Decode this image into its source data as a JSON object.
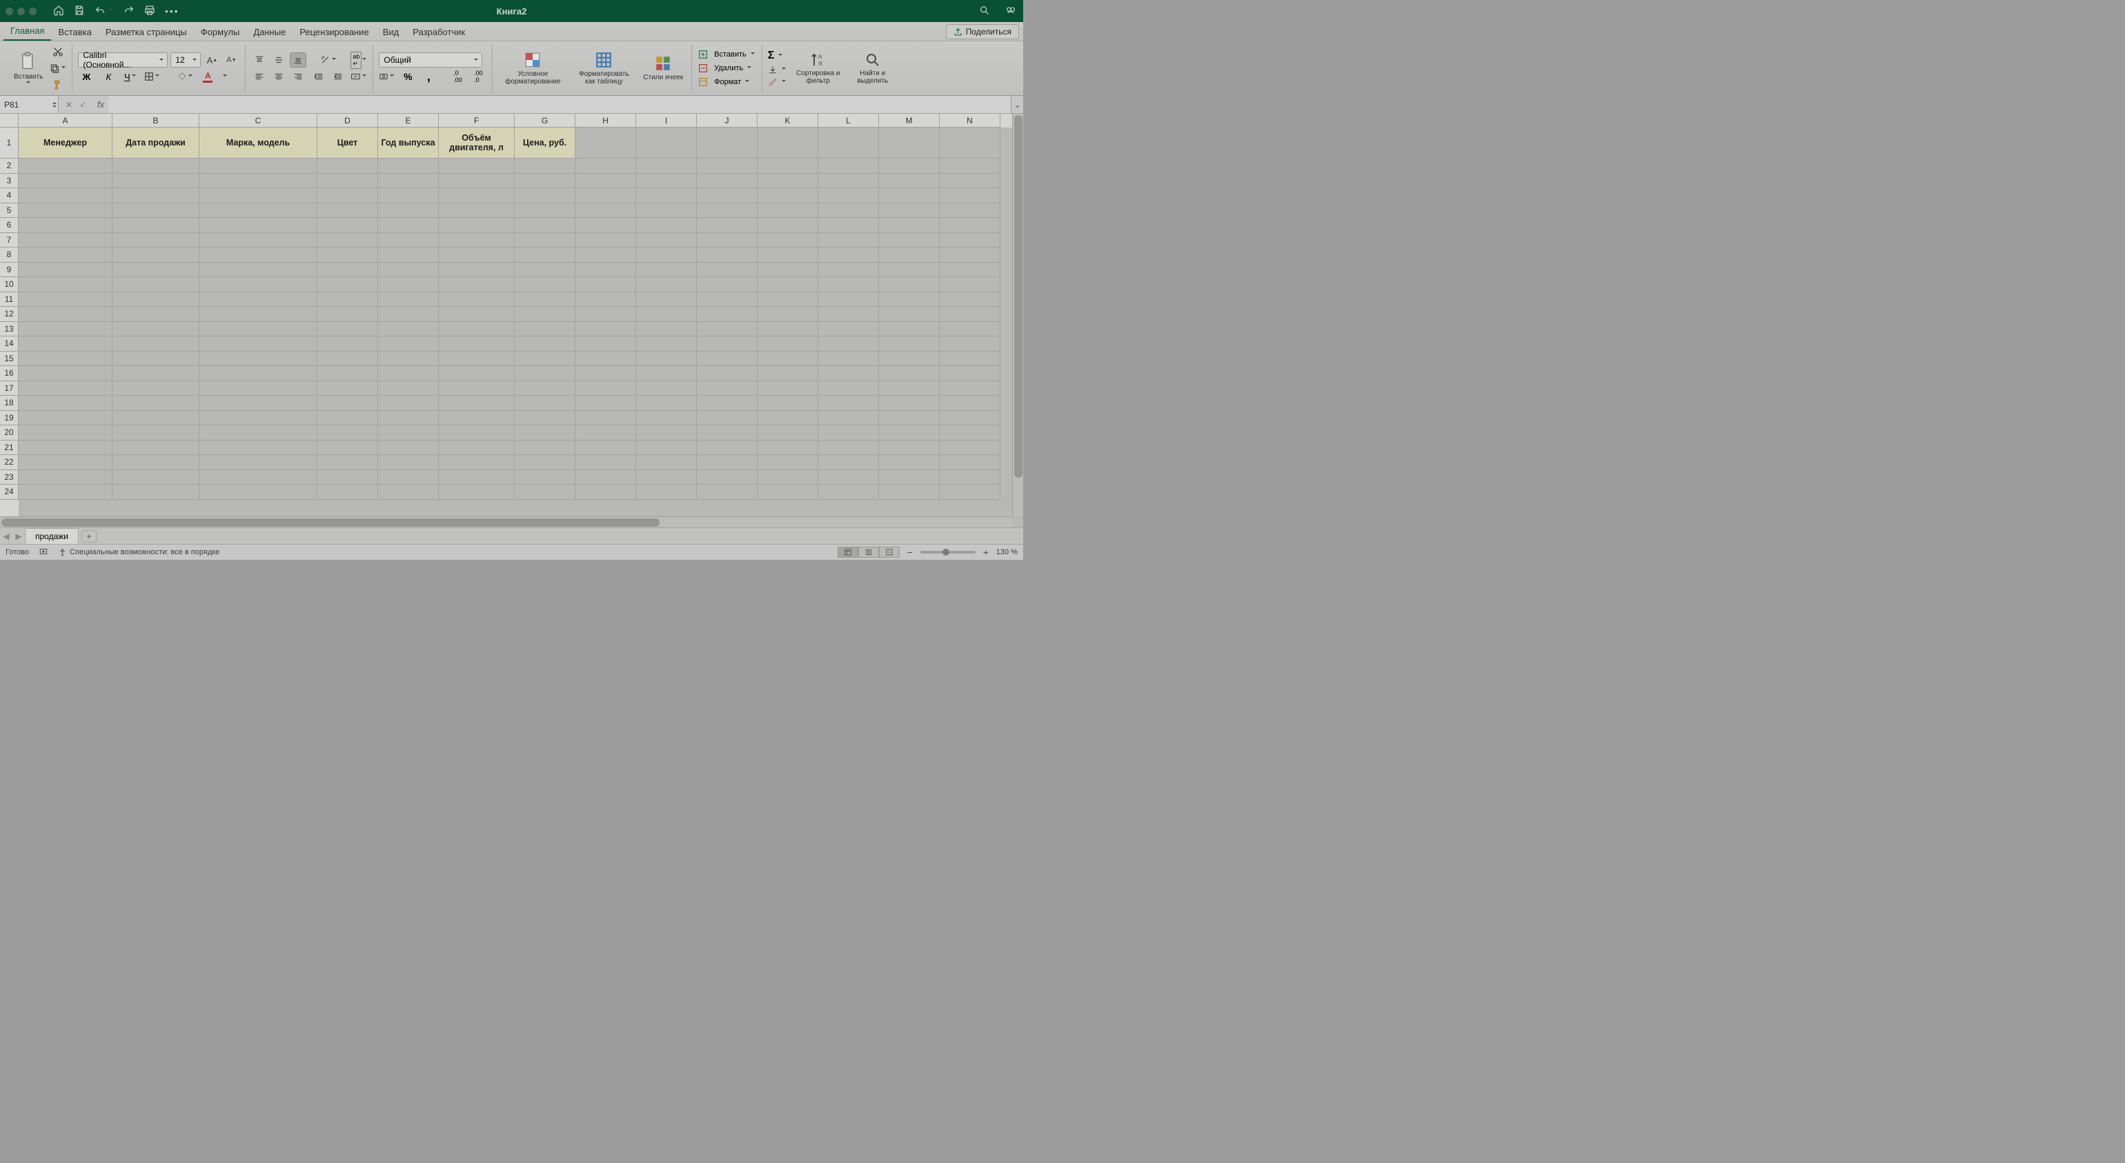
{
  "title": "Книга2",
  "tabs": [
    "Главная",
    "Вставка",
    "Разметка страницы",
    "Формулы",
    "Данные",
    "Рецензирование",
    "Вид",
    "Разработчик"
  ],
  "activeTab": 0,
  "share": "Поделиться",
  "clipboard": {
    "paste": "Вставить"
  },
  "font": {
    "name": "Calibri (Основной...",
    "size": "12"
  },
  "numberFormat": "Общий",
  "ribbonBtns": {
    "condFmt": "Условное форматирование",
    "fmtTable": "Форматировать как таблицу",
    "cellStyles": "Стили ячеек",
    "insert": "Вставить",
    "delete": "Удалить",
    "format": "Формат",
    "sort": "Сортировка и фильтр",
    "find": "Найти и выделить"
  },
  "nameBox": "P81",
  "columns": [
    {
      "l": "A",
      "w": 136
    },
    {
      "l": "B",
      "w": 126
    },
    {
      "l": "C",
      "w": 171
    },
    {
      "l": "D",
      "w": 88
    },
    {
      "l": "E",
      "w": 88
    },
    {
      "l": "F",
      "w": 110
    },
    {
      "l": "G",
      "w": 88
    },
    {
      "l": "H",
      "w": 88
    },
    {
      "l": "I",
      "w": 88
    },
    {
      "l": "J",
      "w": 88
    },
    {
      "l": "K",
      "w": 88
    },
    {
      "l": "L",
      "w": 88
    },
    {
      "l": "M",
      "w": 88
    },
    {
      "l": "N",
      "w": 88
    }
  ],
  "headerRow": [
    "Менеджер",
    "Дата продажи",
    "Марка, модель",
    "Цвет",
    "Год выпуска",
    "Объём двигателя, л",
    "Цена, руб."
  ],
  "rowCount": 24,
  "sheetName": "продажи",
  "status": {
    "ready": "Готово",
    "accessibility": "Специальные возможности: все в порядке",
    "zoom": "130 %"
  }
}
